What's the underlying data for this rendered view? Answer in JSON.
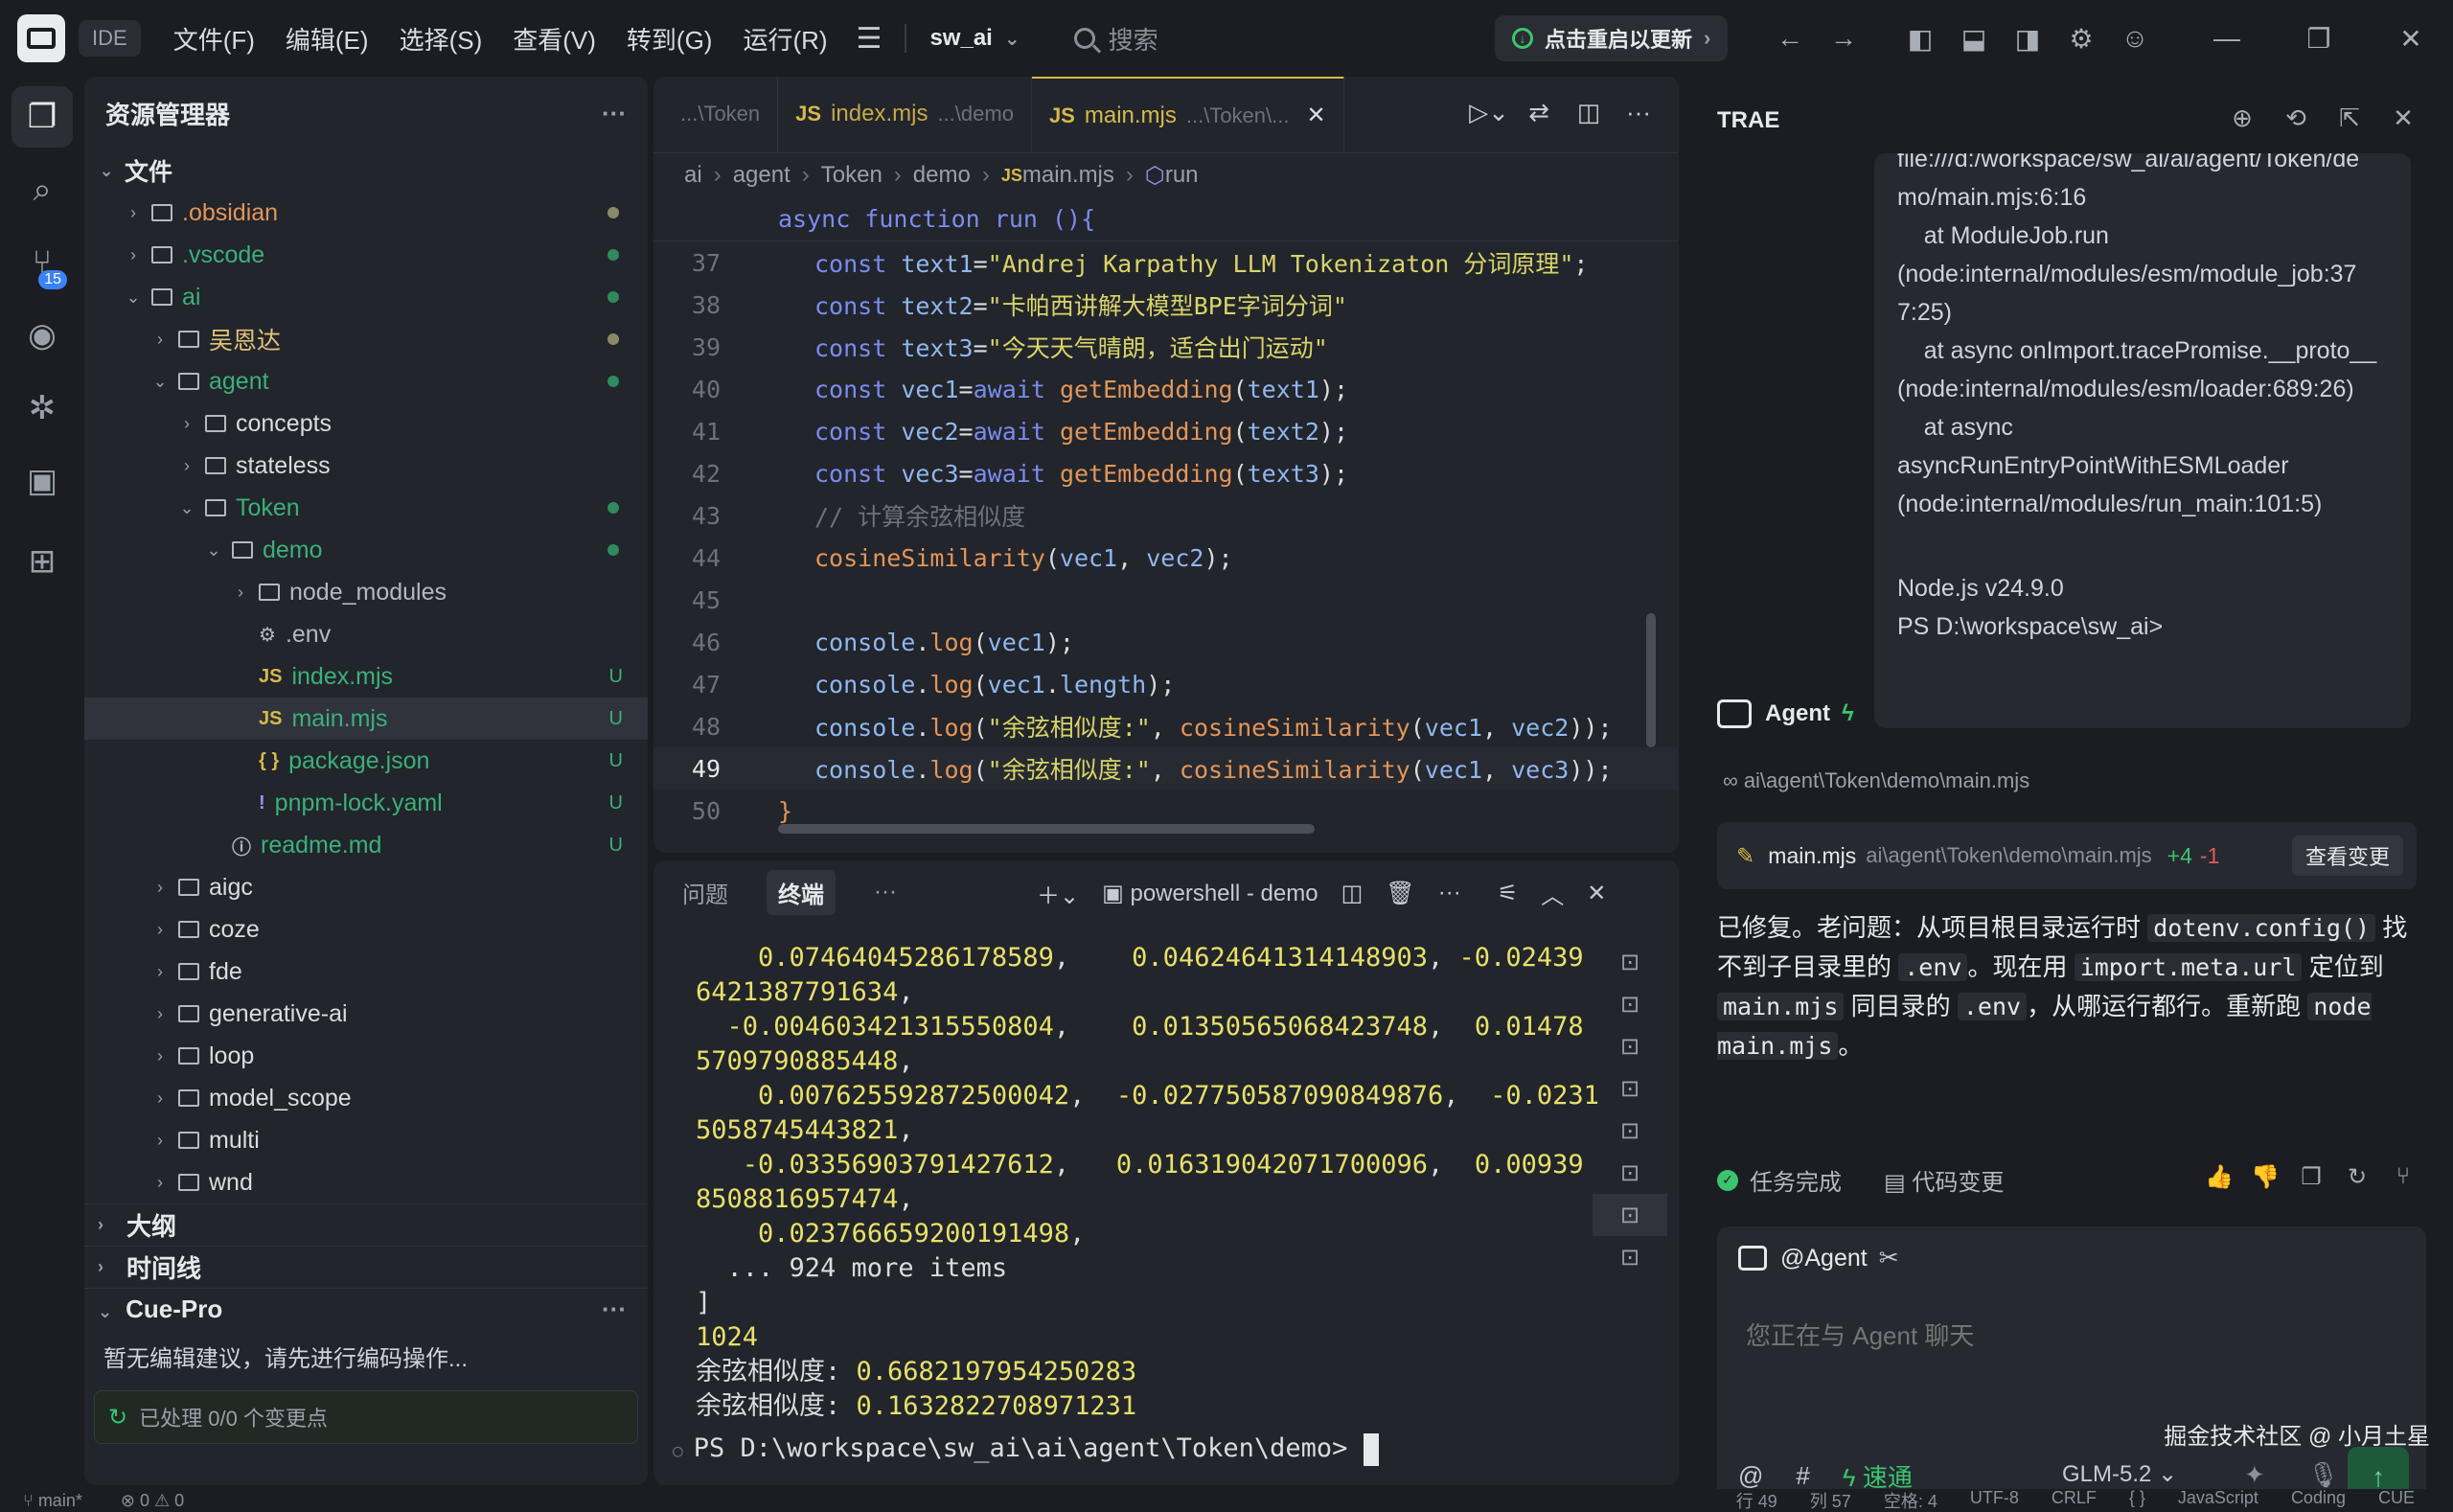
{
  "titlebar": {
    "ide_tag": "IDE",
    "menu": [
      "文件(F)",
      "编辑(E)",
      "选择(S)",
      "查看(V)",
      "转到(G)",
      "运行(R)"
    ],
    "project": "sw_ai",
    "search_placeholder": "搜索",
    "update_label": "点击重启以更新"
  },
  "activity": {
    "scm_badge": "15"
  },
  "explorer": {
    "title": "资源管理器",
    "files_section": "文件",
    "tree": [
      {
        "label": ".obsidian",
        "depth": 0,
        "type": "folder",
        "open": false,
        "color": "#e2955a",
        "dot": "#8a8a6a"
      },
      {
        "label": ".vscode",
        "depth": 0,
        "type": "folder",
        "open": false,
        "color": "#3bb07a",
        "dot": "#2f8a5f"
      },
      {
        "label": "ai",
        "depth": 0,
        "type": "folder",
        "open": true,
        "color": "#3bb07a",
        "dot": "#2f8a5f"
      },
      {
        "label": "吴恩达",
        "depth": 1,
        "type": "folder",
        "open": false,
        "color": "#e2c27a",
        "dot": "#8a8a6a"
      },
      {
        "label": "agent",
        "depth": 1,
        "type": "folder",
        "open": true,
        "color": "#3bb07a",
        "dot": "#2f8a5f"
      },
      {
        "label": "concepts",
        "depth": 2,
        "type": "folder",
        "open": false,
        "color": "#d9dce1"
      },
      {
        "label": "stateless",
        "depth": 2,
        "type": "folder",
        "open": false,
        "color": "#d9dce1"
      },
      {
        "label": "Token",
        "depth": 2,
        "type": "folder",
        "open": true,
        "color": "#3bb07a",
        "dot": "#2f8a5f"
      },
      {
        "label": "demo",
        "depth": 3,
        "type": "folder",
        "open": true,
        "color": "#3bb07a",
        "dot": "#2f8a5f"
      },
      {
        "label": "node_modules",
        "depth": 4,
        "type": "folder",
        "open": false,
        "color": "#b4b8bf"
      },
      {
        "label": ".env",
        "depth": 4,
        "type": "gear",
        "color": "#b4b8bf"
      },
      {
        "label": "index.mjs",
        "depth": 4,
        "type": "js",
        "color": "#3bb07a",
        "mark": "U"
      },
      {
        "label": "main.mjs",
        "depth": 4,
        "type": "js",
        "color": "#3bb07a",
        "mark": "U",
        "selected": true
      },
      {
        "label": "package.json",
        "depth": 4,
        "type": "json",
        "color": "#3bb07a",
        "mark": "U"
      },
      {
        "label": "pnpm-lock.yaml",
        "depth": 4,
        "type": "yaml",
        "color": "#3bb07a",
        "mark": "U"
      },
      {
        "label": "readme.md",
        "depth": 3,
        "type": "info",
        "color": "#3bb07a",
        "mark": "U"
      },
      {
        "label": "aigc",
        "depth": 1,
        "type": "folder",
        "open": false,
        "color": "#d9dce1"
      },
      {
        "label": "coze",
        "depth": 1,
        "type": "folder",
        "open": false,
        "color": "#d9dce1"
      },
      {
        "label": "fde",
        "depth": 1,
        "type": "folder",
        "open": false,
        "color": "#d9dce1"
      },
      {
        "label": "generative-ai",
        "depth": 1,
        "type": "folder",
        "open": false,
        "color": "#d9dce1"
      },
      {
        "label": "loop",
        "depth": 1,
        "type": "folder",
        "open": false,
        "color": "#d9dce1"
      },
      {
        "label": "model_scope",
        "depth": 1,
        "type": "folder",
        "open": false,
        "color": "#d9dce1"
      },
      {
        "label": "multi",
        "depth": 1,
        "type": "folder",
        "open": false,
        "color": "#d9dce1"
      },
      {
        "label": "wnd",
        "depth": 1,
        "type": "folder",
        "open": false,
        "color": "#d9dce1"
      }
    ],
    "outline_section": "大纲",
    "timeline_section": "时间线",
    "cuepro_section": "Cue-Pro",
    "cuepro_message": "暂无编辑建议，请先进行编码操作...",
    "cuepro_status": "已处理 0/0 个变更点"
  },
  "editor": {
    "tabs": [
      {
        "js": "",
        "name": "",
        "path": "...\\Token",
        "active": false
      },
      {
        "js": "JS",
        "name": "index.mjs",
        "path": "...\\demo",
        "active": false
      },
      {
        "js": "JS",
        "name": "main.mjs",
        "path": "...\\Token\\...",
        "active": true
      }
    ],
    "breadcrumb": [
      "ai",
      "agent",
      "Token",
      "demo",
      "main.mjs",
      "run"
    ],
    "sticky": "async function run (){",
    "lines": [
      {
        "n": "37",
        "html": "<span class=\"kw\">const</span> <span class=\"var\">text1</span><span class=\"pl\">=</span><span class=\"str\">\"Andrej Karpathy LLM Tokenizaton 分词原理\"</span><span class=\"pl\">;</span>"
      },
      {
        "n": "38",
        "html": "<span class=\"kw\">const</span> <span class=\"var\">text2</span><span class=\"pl\">=</span><span class=\"str\">\"卡帕西讲解大模型BPE字词分词\"</span>"
      },
      {
        "n": "39",
        "html": "<span class=\"kw\">const</span> <span class=\"var\">text3</span><span class=\"pl\">=</span><span class=\"str\">\"今天天气晴朗，适合出门运动\"</span>"
      },
      {
        "n": "40",
        "html": "<span class=\"kw\">const</span> <span class=\"var\">vec1</span><span class=\"pl\">=</span><span class=\"kw\">await</span> <span class=\"fn\">getEmbedding</span><span class=\"pl\">(</span><span class=\"var\">text1</span><span class=\"pl\">);</span>"
      },
      {
        "n": "41",
        "html": "<span class=\"kw\">const</span> <span class=\"var\">vec2</span><span class=\"pl\">=</span><span class=\"kw\">await</span> <span class=\"fn\">getEmbedding</span><span class=\"pl\">(</span><span class=\"var\">text2</span><span class=\"pl\">);</span>"
      },
      {
        "n": "42",
        "html": "<span class=\"kw\">const</span> <span class=\"var\">vec3</span><span class=\"pl\">=</span><span class=\"kw\">await</span> <span class=\"fn\">getEmbedding</span><span class=\"pl\">(</span><span class=\"var\">text3</span><span class=\"pl\">);</span>"
      },
      {
        "n": "43",
        "html": "<span class=\"cm\">// 计算余弦相似度</span>"
      },
      {
        "n": "44",
        "html": "<span class=\"fn\">cosineSimilarity</span><span class=\"pl\">(</span><span class=\"var\">vec1</span><span class=\"pl\">, </span><span class=\"var\">vec2</span><span class=\"pl\">);</span>"
      },
      {
        "n": "45",
        "html": ""
      },
      {
        "n": "46",
        "html": "<span class=\"var\">console</span><span class=\"pl\">.</span><span class=\"fn\">log</span><span class=\"pl\">(</span><span class=\"var\">vec1</span><span class=\"pl\">);</span>"
      },
      {
        "n": "47",
        "html": "<span class=\"var\">console</span><span class=\"pl\">.</span><span class=\"fn\">log</span><span class=\"pl\">(</span><span class=\"var\">vec1</span><span class=\"pl\">.</span><span class=\"var\">length</span><span class=\"pl\">);</span>"
      },
      {
        "n": "48",
        "html": "<span class=\"var\">console</span><span class=\"pl\">.</span><span class=\"fn\">log</span><span class=\"pl\">(</span><span class=\"str\">\"余弦相似度:\"</span><span class=\"pl\">, </span><span class=\"fn\">cosineSimilarity</span><span class=\"pl\">(</span><span class=\"var\">vec1</span><span class=\"pl\">, </span><span class=\"var\">vec2</span><span class=\"pl\">));</span>"
      },
      {
        "n": "49",
        "html": "<span class=\"var\">console</span><span class=\"pl\">.</span><span class=\"fn\">log</span><span class=\"pl\">(</span><span class=\"str\">\"余弦相似度:\"</span><span class=\"pl\">, </span><span class=\"fn\">cosineSimilarity</span><span class=\"pl\">(</span><span class=\"var\">vec1</span><span class=\"pl\">, </span><span class=\"var\">vec3</span><span class=\"pl\">));</span>",
        "current": true
      },
      {
        "n": "50",
        "html": "<span class=\"fn\">}</span>",
        "outdent": true
      }
    ]
  },
  "terminal": {
    "tabs": [
      "问题",
      "终端"
    ],
    "active_tab": "终端",
    "shell": "powershell - demo",
    "output": [
      {
        "parts": [
          [
            "    ",
            ""
          ],
          [
            "0.07464045286178589",
            "n"
          ],
          [
            ",    ",
            ""
          ],
          [
            "0.04624641314148903",
            "n"
          ],
          [
            ", ",
            ""
          ],
          [
            "-0.02439",
            "n"
          ]
        ]
      },
      {
        "parts": [
          [
            "6421387791634",
            "n"
          ],
          [
            ",",
            ""
          ]
        ]
      },
      {
        "parts": [
          [
            "  ",
            ""
          ],
          [
            "-0.004603421315550804",
            "n"
          ],
          [
            ",    ",
            ""
          ],
          [
            "0.01350565068423748",
            "n"
          ],
          [
            ",  ",
            ""
          ],
          [
            "0.01478",
            "n"
          ]
        ]
      },
      {
        "parts": [
          [
            "5709790885448",
            "n"
          ],
          [
            ",",
            ""
          ]
        ]
      },
      {
        "parts": [
          [
            "    ",
            ""
          ],
          [
            "0.007625592872500042",
            "n"
          ],
          [
            ",  ",
            ""
          ],
          [
            "-0.027750587090849876",
            "n"
          ],
          [
            ",  ",
            ""
          ],
          [
            "-0.0231",
            "n"
          ]
        ]
      },
      {
        "parts": [
          [
            "5058745443821",
            "n"
          ],
          [
            ",",
            ""
          ]
        ]
      },
      {
        "parts": [
          [
            "   ",
            ""
          ],
          [
            "-0.03356903791427612",
            "n"
          ],
          [
            ",   ",
            ""
          ],
          [
            "0.016319042071700096",
            "n"
          ],
          [
            ",  ",
            ""
          ],
          [
            "0.00939",
            "n"
          ]
        ]
      },
      {
        "parts": [
          [
            "8508816957474",
            "n"
          ],
          [
            ",",
            ""
          ]
        ]
      },
      {
        "parts": [
          [
            "    ",
            ""
          ],
          [
            "0.023766659200191498",
            "n"
          ],
          [
            ",",
            ""
          ]
        ]
      },
      {
        "parts": [
          [
            "  ... 924 more items",
            ""
          ]
        ]
      },
      {
        "parts": [
          [
            "]",
            ""
          ]
        ]
      },
      {
        "parts": [
          [
            "1024",
            "n"
          ]
        ]
      },
      {
        "parts": [
          [
            "余弦相似度: ",
            ""
          ],
          [
            "0.6682197954250283",
            "n"
          ]
        ]
      },
      {
        "parts": [
          [
            "余弦相似度: ",
            ""
          ],
          [
            "0.1632822708971231",
            "n"
          ]
        ]
      }
    ],
    "prompt": "PS D:\\workspace\\sw_ai\\ai\\agent\\Token\\demo> "
  },
  "trae": {
    "title": "TRAE",
    "error_lines": [
      "file:///d:/workspace/sw_ai/ai/agent/Token/de",
      "mo/main.mjs:6:16",
      "    at ModuleJob.run",
      "(node:internal/modules/esm/module_job:37",
      "7:25)",
      "    at async onImport.tracePromise.__proto__",
      "(node:internal/modules/esm/loader:689:26)",
      "    at async",
      "asyncRunEntryPointWithESMLoader",
      "(node:internal/modules/run_main:101:5)",
      "",
      "Node.js v24.9.0",
      "PS D:\\workspace\\sw_ai>"
    ],
    "agent_label": "Agent",
    "context_path": "ai\\agent\\Token\\demo\\main.mjs",
    "change": {
      "file": "main.mjs",
      "path": "ai\\agent\\Token\\demo\\main.mjs",
      "added": "+4",
      "removed": "-1",
      "button": "查看变更"
    },
    "message_html": "已修复。老问题：从项目根目录运行时 <code>dotenv.config()</code> 找不到子目录里的 <code>.env</code>。现在用 <code>import.meta.url</code> 定位到 <code>main.mjs</code> 同目录的 <code>.env</code>，从哪运行都行。重新跑 <code>node main.mjs</code>。",
    "task_done": "任务完成",
    "code_change": "代码变更",
    "chat_target": "@Agent",
    "chat_placeholder": "您正在与 Agent 聊天",
    "speed_label": "速通",
    "model": "GLM-5.2",
    "watermark": "掘金技术社区 @ 小月土星"
  },
  "statusbar": {
    "left": "main*",
    "errors": "0",
    "warnings": "0",
    "right": [
      "行 49",
      "列 57",
      "空格: 4",
      "UTF-8",
      "CRLF",
      "{ }",
      "JavaScript",
      "Coding",
      "CUE"
    ]
  }
}
